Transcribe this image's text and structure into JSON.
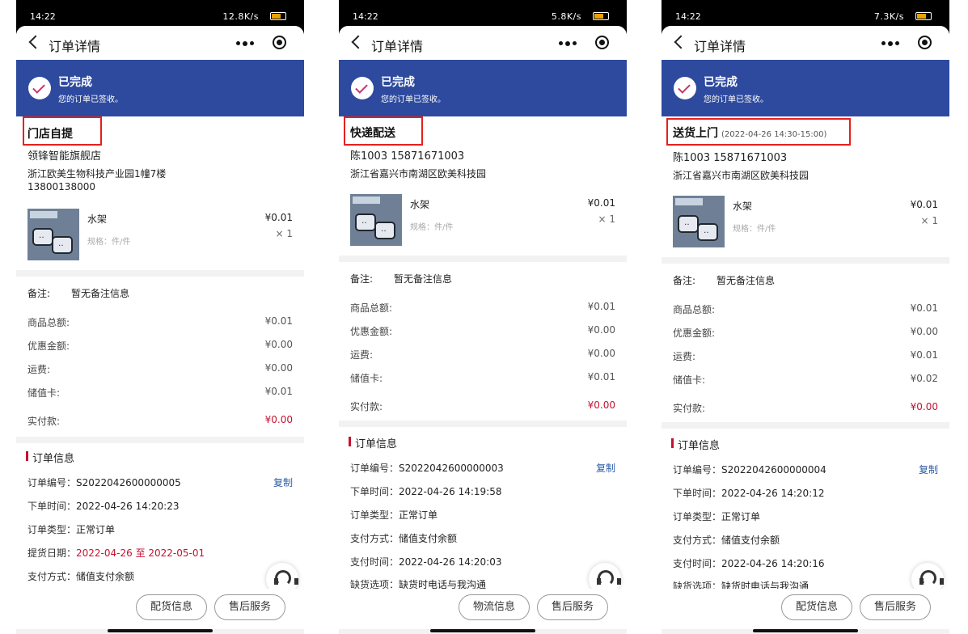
{
  "phones": [
    {
      "status": {
        "time": "14:22",
        "net": "12.8K/s"
      },
      "nav": {
        "title": "订单详情"
      },
      "banner": {
        "status": "已完成",
        "sub": "您的订单已签收。"
      },
      "delivery": {
        "type": "门店自提",
        "time": ""
      },
      "address": {
        "line1": "领锋智能旗舰店",
        "line2": "浙江欧美生物科技产业园1幢7楼",
        "line3": "13800138000"
      },
      "product": {
        "name": "水架",
        "spec": "规格：件/件",
        "price": "¥0.01",
        "qty": "× 1"
      },
      "remark": {
        "label": "备注:",
        "value": "暂无备注信息"
      },
      "amounts": [
        {
          "label": "商品总额:",
          "value": "¥0.01"
        },
        {
          "label": "优惠金额:",
          "value": "¥0.00"
        },
        {
          "label": "运费:",
          "value": "¥0.00"
        },
        {
          "label": "储值卡:",
          "value": "¥0.01"
        }
      ],
      "paid": {
        "label": "实付款:",
        "value": "¥0.00"
      },
      "order_info": {
        "title": "订单信息",
        "copy": "复制",
        "rows": [
          {
            "label": "订单编号：",
            "value": "S2022042600000005"
          },
          {
            "label": "下单时间：",
            "value": "2022-04-26 14:20:23"
          },
          {
            "label": "订单类型：",
            "value": "正常订单"
          },
          {
            "label": "提货日期：",
            "value": "2022-04-26 至 2022-05-01"
          },
          {
            "label": "支付方式：",
            "value": "储值支付余额"
          }
        ]
      },
      "buttons": [
        "配货信息",
        "售后服务"
      ]
    },
    {
      "status": {
        "time": "14:22",
        "net": "5.8K/s"
      },
      "nav": {
        "title": "订单详情"
      },
      "banner": {
        "status": "已完成",
        "sub": "您的订单已签收。"
      },
      "delivery": {
        "type": "快递配送",
        "time": ""
      },
      "address": {
        "line1": "陈1003   15871671003",
        "line2": "浙江省嘉兴市南湖区欧美科技园",
        "line3": ""
      },
      "product": {
        "name": "水架",
        "spec": "规格：件/件",
        "price": "¥0.01",
        "qty": "× 1"
      },
      "remark": {
        "label": "备注:",
        "value": "暂无备注信息"
      },
      "amounts": [
        {
          "label": "商品总额:",
          "value": "¥0.01"
        },
        {
          "label": "优惠金额:",
          "value": "¥0.00"
        },
        {
          "label": "运费:",
          "value": "¥0.00"
        },
        {
          "label": "储值卡:",
          "value": "¥0.01"
        }
      ],
      "paid": {
        "label": "实付款:",
        "value": "¥0.00"
      },
      "order_info": {
        "title": "订单信息",
        "copy": "复制",
        "rows": [
          {
            "label": "订单编号：",
            "value": "S2022042600000003"
          },
          {
            "label": "下单时间：",
            "value": "2022-04-26 14:19:58"
          },
          {
            "label": "订单类型：",
            "value": "正常订单"
          },
          {
            "label": "支付方式：",
            "value": "储值支付余额"
          },
          {
            "label": "支付时间：",
            "value": "2022-04-26 14:20:03"
          },
          {
            "label": "缺货选项：",
            "value": "缺货时电话与我沟通"
          }
        ]
      },
      "buttons": [
        "物流信息",
        "售后服务"
      ]
    },
    {
      "status": {
        "time": "14:22",
        "net": "7.3K/s"
      },
      "nav": {
        "title": "订单详情"
      },
      "banner": {
        "status": "已完成",
        "sub": "您的订单已签收。"
      },
      "delivery": {
        "type": "送货上门",
        "time": "(2022-04-26 14:30-15:00)"
      },
      "address": {
        "line1": "陈1003   15871671003",
        "line2": "浙江省嘉兴市南湖区欧美科技园",
        "line3": ""
      },
      "product": {
        "name": "水架",
        "spec": "规格：件/件",
        "price": "¥0.01",
        "qty": "× 1"
      },
      "remark": {
        "label": "备注:",
        "value": "暂无备注信息"
      },
      "amounts": [
        {
          "label": "商品总额:",
          "value": "¥0.01"
        },
        {
          "label": "优惠金额:",
          "value": "¥0.00"
        },
        {
          "label": "运费:",
          "value": "¥0.01"
        },
        {
          "label": "储值卡:",
          "value": "¥0.02"
        }
      ],
      "paid": {
        "label": "实付款:",
        "value": "¥0.00"
      },
      "order_info": {
        "title": "订单信息",
        "copy": "复制",
        "rows": [
          {
            "label": "订单编号：",
            "value": "S2022042600000004"
          },
          {
            "label": "下单时间：",
            "value": "2022-04-26 14:20:12"
          },
          {
            "label": "订单类型：",
            "value": "正常订单"
          },
          {
            "label": "支付方式：",
            "value": "储值支付余额"
          },
          {
            "label": "支付时间：",
            "value": "2022-04-26 14:20:16"
          },
          {
            "label": "缺货选项：",
            "value": "缺货时电话与我沟通"
          }
        ]
      },
      "buttons": [
        "配货信息",
        "售后服务"
      ]
    }
  ]
}
